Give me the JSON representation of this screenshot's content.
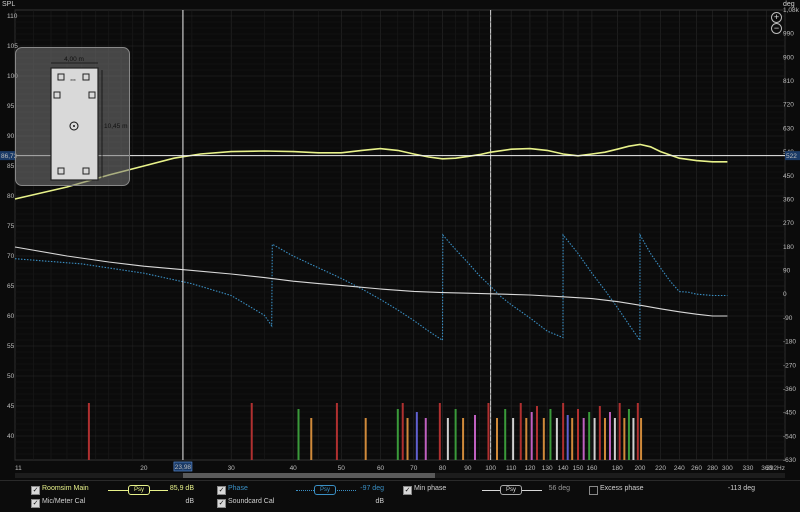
{
  "chart_data": {
    "type": "line",
    "xlabel_unit": "Hz",
    "ylabel_left": "SPL",
    "ylabel_right": "deg",
    "x_scale": "log",
    "xlim": [
      11,
      392
    ],
    "ylim_left": [
      36,
      111
    ],
    "ylim_right": [
      -630,
      1080
    ],
    "x_ticks": [
      11,
      20,
      30,
      40,
      50,
      60,
      70,
      80,
      90,
      100,
      110,
      120,
      130,
      140,
      150,
      160,
      180,
      200,
      220,
      240,
      260,
      280,
      300,
      330,
      360,
      392
    ],
    "x_tick_labels": [
      "11",
      "20",
      "30",
      "40",
      "50",
      "60",
      "70",
      "80",
      "90",
      "100",
      "110",
      "120",
      "130",
      "140",
      "150",
      "160",
      "180",
      "200",
      "220",
      "240",
      "260",
      "280",
      "300",
      "330",
      "360",
      "392Hz"
    ],
    "y_ticks_left": [
      40,
      45,
      50,
      55,
      60,
      65,
      70,
      75,
      80,
      85,
      90,
      95,
      100,
      105,
      110
    ],
    "y_ticks_right": [
      -630,
      -540,
      -450,
      -360,
      -270,
      -180,
      -90,
      0,
      90,
      180,
      270,
      360,
      450,
      540,
      630,
      720,
      810,
      900,
      990,
      1080
    ],
    "y_tick_labels_right": [
      "-630",
      "-540",
      "-450",
      "-360",
      "-270",
      "-180",
      "-90",
      "0",
      "90",
      "180",
      "270",
      "360",
      "450",
      "540",
      "630",
      "720",
      "810",
      "900",
      "990",
      "1,08k"
    ],
    "grid": true,
    "cursor": {
      "x": 23.98,
      "x_label": "23,98",
      "y_left_label": "86,73",
      "y_right_label": "522"
    },
    "series": [
      {
        "name": "Roomsim Main",
        "axis": "left",
        "color": "#e8f28a",
        "x": [
          11,
          14,
          17,
          20,
          23,
          26,
          30,
          35,
          40,
          45,
          50,
          55,
          60,
          65,
          70,
          75,
          80,
          85,
          90,
          95,
          100,
          110,
          120,
          130,
          140,
          150,
          160,
          170,
          180,
          190,
          200,
          210,
          220,
          240,
          260,
          280,
          300
        ],
        "y": [
          79.5,
          81.5,
          83.5,
          85,
          86.3,
          87,
          87.4,
          87.5,
          87.4,
          87.2,
          87.2,
          87.6,
          87.9,
          87.6,
          87,
          86.5,
          86.2,
          86.3,
          86.6,
          86.9,
          87.3,
          87.8,
          87.9,
          87.6,
          87,
          86.7,
          87,
          87.3,
          87.8,
          88.3,
          88.6,
          88.2,
          87.4,
          86.3,
          85.9,
          85.7,
          85.7
        ]
      },
      {
        "name": "Phase",
        "axis": "right",
        "color": "#3a8fc4",
        "dotted": true,
        "x": [
          11,
          15,
          20,
          25,
          30,
          35,
          36.2,
          36.3,
          40,
          45,
          50,
          55,
          60,
          65,
          70,
          75,
          80,
          80.1,
          85,
          90,
          95,
          100,
          105,
          110,
          120,
          130,
          139.9,
          140,
          150,
          160,
          170,
          180,
          190,
          199.9,
          200,
          210,
          220,
          230,
          240,
          250,
          260,
          280,
          300
        ],
        "y": [
          135,
          115,
          80,
          40,
          -5,
          -80,
          -120,
          190,
          145,
          100,
          60,
          20,
          -20,
          -60,
          -100,
          -140,
          -175,
          225,
          170,
          120,
          70,
          30,
          -10,
          -40,
          -90,
          -140,
          -165,
          225,
          155,
          80,
          15,
          -50,
          -115,
          -175,
          225,
          155,
          100,
          50,
          10,
          8,
          0,
          -5,
          -5
        ]
      },
      {
        "name": "Min phase",
        "axis": "left",
        "color": "#d9d9d9",
        "x": [
          11,
          14,
          17,
          20,
          25,
          30,
          35,
          40,
          45,
          50,
          60,
          70,
          80,
          90,
          100,
          110,
          120,
          140,
          160,
          180,
          200,
          220,
          240,
          260,
          280,
          300
        ],
        "y": [
          71.5,
          70,
          69,
          68.3,
          67.6,
          67,
          66.4,
          65.8,
          65.4,
          65.1,
          64.5,
          64.1,
          63.9,
          63.8,
          63.7,
          63.6,
          63.5,
          63.2,
          62.9,
          62.4,
          61.8,
          61.2,
          60.7,
          60.3,
          60,
          60
        ]
      }
    ],
    "modes": [
      {
        "x": 15.5,
        "h": 45.5,
        "c": "#b03030"
      },
      {
        "x": 33,
        "h": 45.5,
        "c": "#b03030"
      },
      {
        "x": 41,
        "h": 44.5,
        "c": "#3a9a3a"
      },
      {
        "x": 43.5,
        "h": 43,
        "c": "#d08a3a"
      },
      {
        "x": 49,
        "h": 45.5,
        "c": "#b03030"
      },
      {
        "x": 56,
        "h": 43,
        "c": "#d08a3a"
      },
      {
        "x": 65,
        "h": 44.5,
        "c": "#3a9a3a"
      },
      {
        "x": 66.5,
        "h": 45.5,
        "c": "#b03030"
      },
      {
        "x": 68,
        "h": 43,
        "c": "#d08a3a"
      },
      {
        "x": 71,
        "h": 44,
        "c": "#6060d0"
      },
      {
        "x": 74,
        "h": 43,
        "c": "#c060c0"
      },
      {
        "x": 79,
        "h": 45.5,
        "c": "#b03030"
      },
      {
        "x": 82,
        "h": 43,
        "c": "#d0d0d0"
      },
      {
        "x": 85,
        "h": 44.5,
        "c": "#3a9a3a"
      },
      {
        "x": 88,
        "h": 43,
        "c": "#d08a3a"
      },
      {
        "x": 93,
        "h": 43.5,
        "c": "#c060c0"
      },
      {
        "x": 99,
        "h": 45.5,
        "c": "#b03030"
      },
      {
        "x": 103,
        "h": 43,
        "c": "#d08a3a"
      },
      {
        "x": 107,
        "h": 44.5,
        "c": "#3a9a3a"
      },
      {
        "x": 111,
        "h": 43,
        "c": "#d0d0d0"
      },
      {
        "x": 115,
        "h": 45.5,
        "c": "#b03030"
      },
      {
        "x": 118,
        "h": 43,
        "c": "#d08a3a"
      },
      {
        "x": 121,
        "h": 44,
        "c": "#c060c0"
      },
      {
        "x": 124,
        "h": 45,
        "c": "#b03030"
      },
      {
        "x": 128,
        "h": 43,
        "c": "#d08a3a"
      },
      {
        "x": 132,
        "h": 44.5,
        "c": "#3a9a3a"
      },
      {
        "x": 136,
        "h": 43,
        "c": "#d0d0d0"
      },
      {
        "x": 140,
        "h": 45.5,
        "c": "#b03030"
      },
      {
        "x": 143,
        "h": 43.5,
        "c": "#6060d0"
      },
      {
        "x": 146,
        "h": 43,
        "c": "#d08a3a"
      },
      {
        "x": 150,
        "h": 44.5,
        "c": "#b03030"
      },
      {
        "x": 154,
        "h": 43,
        "c": "#c060c0"
      },
      {
        "x": 158,
        "h": 44,
        "c": "#3a9a3a"
      },
      {
        "x": 162,
        "h": 43,
        "c": "#d0d0d0"
      },
      {
        "x": 166,
        "h": 45,
        "c": "#b03030"
      },
      {
        "x": 170,
        "h": 43,
        "c": "#d08a3a"
      },
      {
        "x": 174,
        "h": 44,
        "c": "#c060c0"
      },
      {
        "x": 178,
        "h": 43,
        "c": "#d0d0d0"
      },
      {
        "x": 182,
        "h": 45.5,
        "c": "#b03030"
      },
      {
        "x": 186,
        "h": 43,
        "c": "#d08a3a"
      },
      {
        "x": 190,
        "h": 44.5,
        "c": "#3a9a3a"
      },
      {
        "x": 194,
        "h": 43,
        "c": "#d0d0d0"
      },
      {
        "x": 198,
        "h": 45.5,
        "c": "#b03030"
      },
      {
        "x": 201,
        "h": 43,
        "c": "#d08a3a"
      }
    ]
  },
  "inset": {
    "width_label": "4,00 m",
    "length_label": "10,45 m",
    "small_label": "xxx"
  },
  "legend": {
    "row1": {
      "main_name": "Roomsim Main",
      "main_pill": "Psy",
      "main_value": "85,9 dB",
      "phase_name": "Phase",
      "phase_pill": "Psy",
      "phase_value": "-97 deg",
      "minphase_name": "Min phase",
      "minphase_pill": "Psy",
      "minphase_value": "56 deg",
      "excess_name": "Excess phase",
      "excess_value": "-113 deg"
    },
    "row2": {
      "mic_name": "Mic/Meter Cal",
      "mic_value": "dB",
      "sound_name": "Soundcard Cal",
      "sound_value": "dB"
    },
    "colors": {
      "main": "#e8f28a",
      "phase": "#3a8fc4",
      "minphase": "#d9d9d9"
    }
  },
  "zoom": {
    "plus": "+",
    "minus": "−"
  }
}
